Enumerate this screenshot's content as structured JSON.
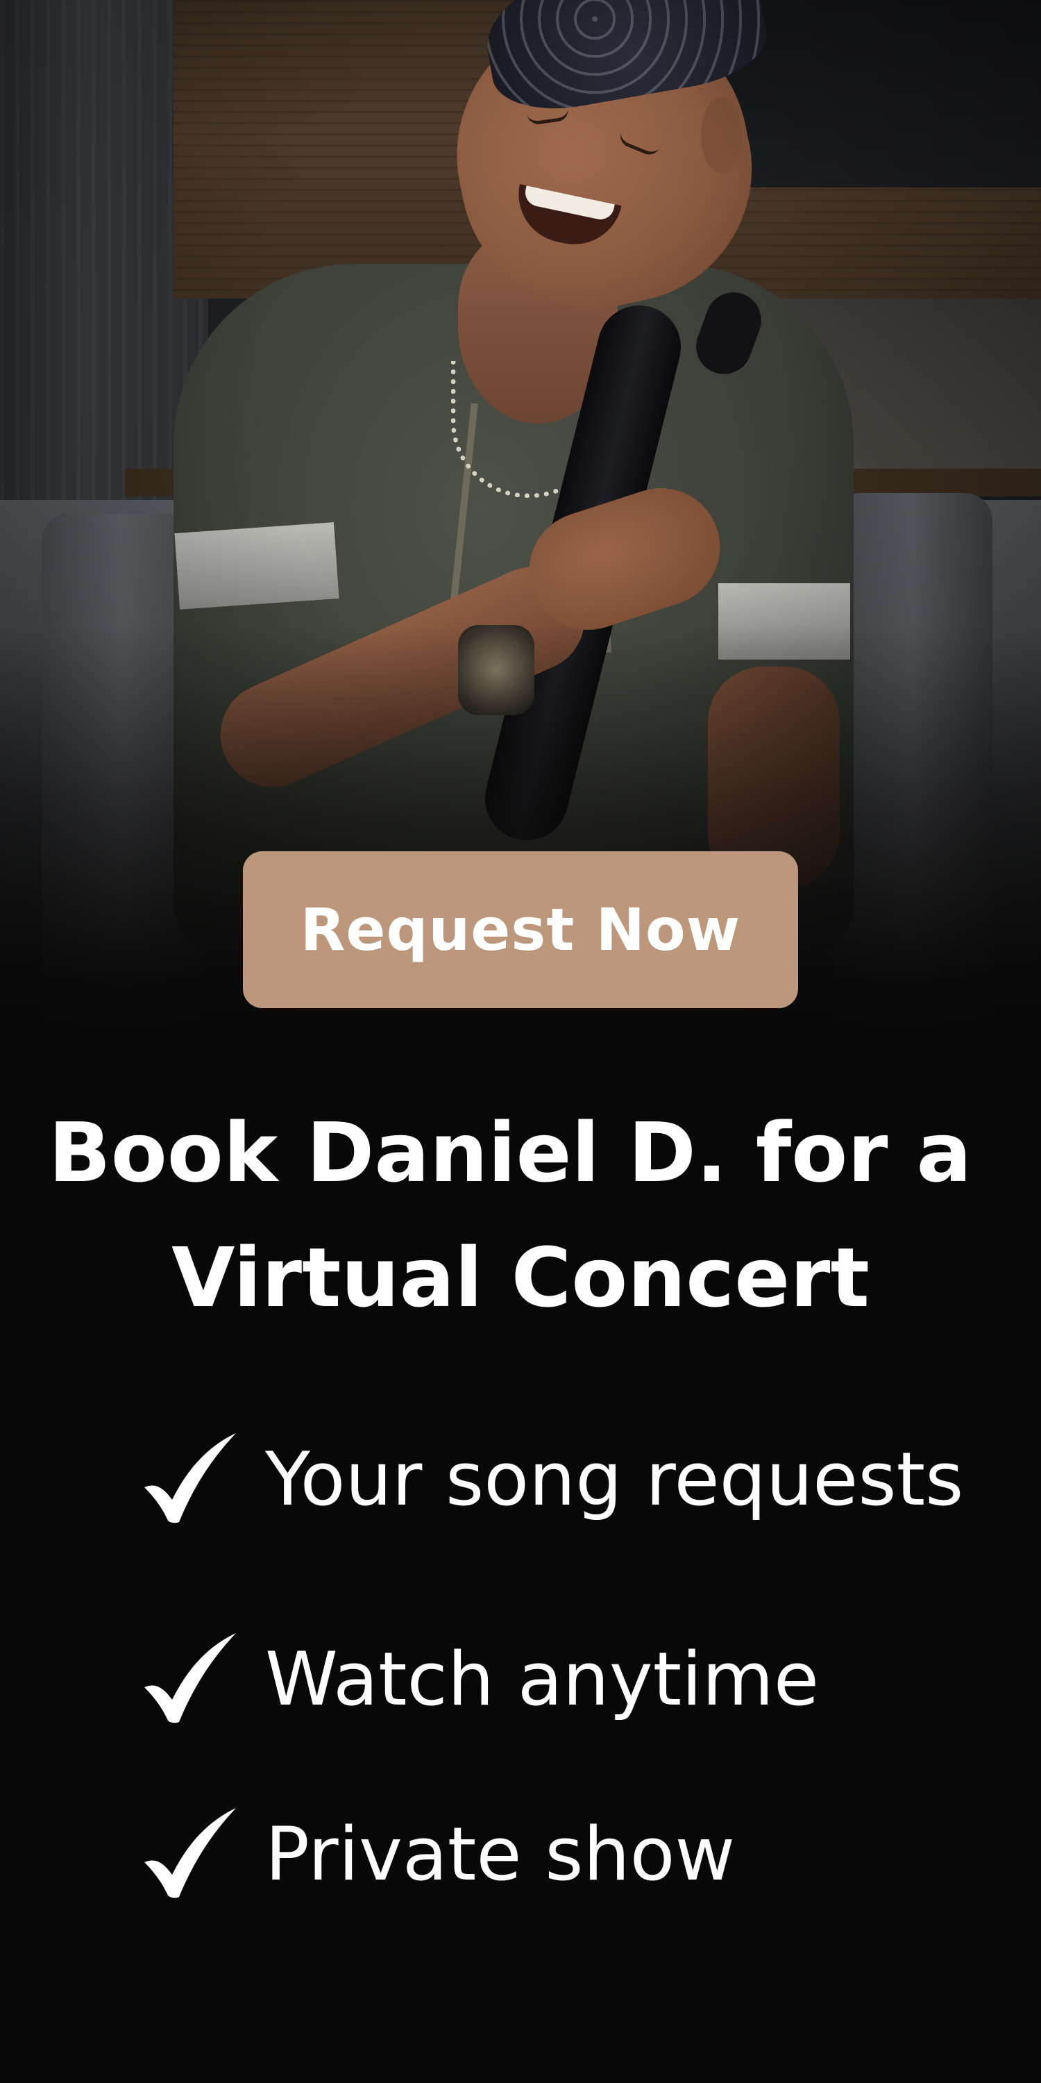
{
  "cta": {
    "label": "Request Now",
    "color": "#bc977b"
  },
  "headline": {
    "line1": "Book Daniel D. for a",
    "line2": "Virtual Concert"
  },
  "benefits": [
    {
      "icon": "checkmark-icon",
      "label": "Your song requests"
    },
    {
      "icon": "checkmark-icon",
      "label": "Watch anytime"
    },
    {
      "icon": "checkmark-icon",
      "label": "Private show"
    }
  ]
}
